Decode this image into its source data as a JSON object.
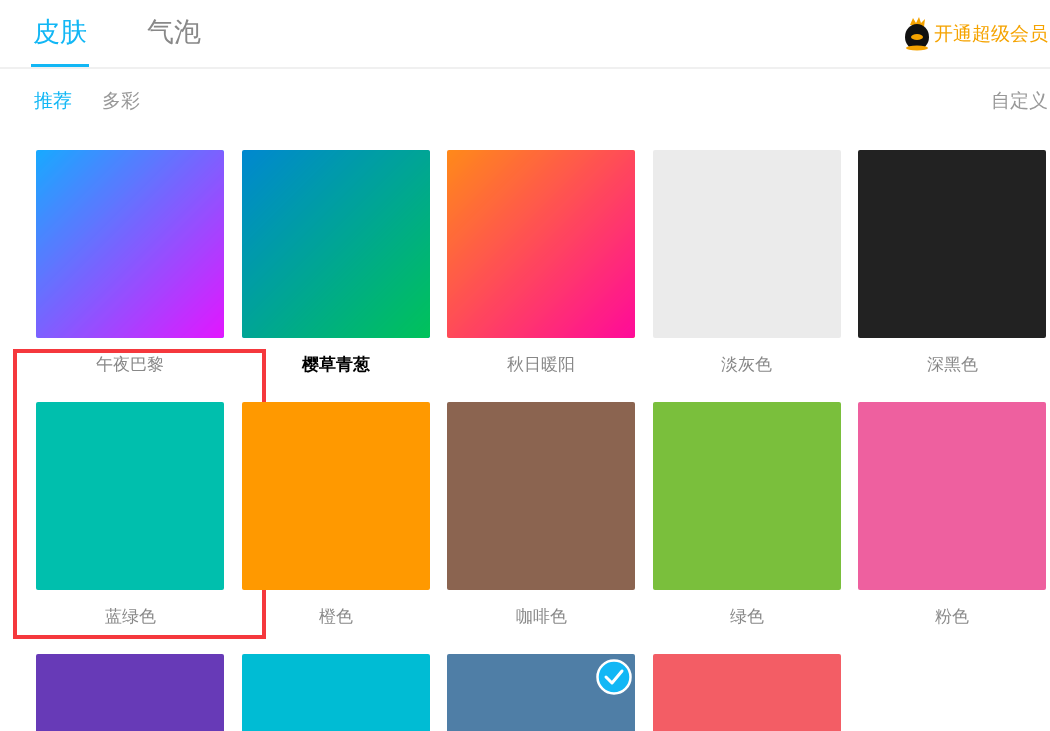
{
  "tabs": [
    {
      "label": "皮肤",
      "selected": true
    },
    {
      "label": "气泡",
      "selected": false
    }
  ],
  "vip_link": "开通超级会员",
  "subtabs": [
    {
      "label": "推荐",
      "selected": true
    },
    {
      "label": "多彩",
      "selected": false
    }
  ],
  "custom_link": "自定义",
  "skins": [
    {
      "name": "午夜巴黎",
      "kind": "gradient",
      "color": "#18aaff",
      "gradient_end": {
        "color": "#e316ff"
      },
      "selected": false,
      "hovered": false,
      "annotated": false
    },
    {
      "name": "樱草青葱",
      "kind": "gradient",
      "color": "#0088d0",
      "gradient_end": {
        "color": "#00c25a"
      },
      "selected": false,
      "hovered": true,
      "annotated": false
    },
    {
      "name": "秋日暖阳",
      "kind": "gradient",
      "color": "#ff8a1a",
      "gradient_end": {
        "color": "#ff0a9a"
      },
      "selected": false,
      "hovered": false,
      "annotated": false
    },
    {
      "name": "淡灰色",
      "kind": "solid",
      "color": "#ebebeb",
      "selected": false,
      "hovered": false,
      "annotated": false
    },
    {
      "name": "深黑色",
      "kind": "solid",
      "color": "#222222",
      "selected": false,
      "hovered": false,
      "annotated": false
    },
    {
      "name": "蓝绿色",
      "kind": "solid",
      "color": "#00bfad",
      "selected": false,
      "hovered": false,
      "annotated": true
    },
    {
      "name": "橙色",
      "kind": "solid",
      "color": "#ff9900",
      "selected": false,
      "hovered": false,
      "annotated": false
    },
    {
      "name": "咖啡色",
      "kind": "solid",
      "color": "#8b6450",
      "selected": false,
      "hovered": false,
      "annotated": false
    },
    {
      "name": "绿色",
      "kind": "solid",
      "color": "#7abf3c",
      "selected": false,
      "hovered": false,
      "annotated": false
    },
    {
      "name": "粉色",
      "kind": "solid",
      "color": "#ee609f",
      "selected": false,
      "hovered": false,
      "annotated": false
    },
    {
      "kind": "solid",
      "color": "#673ab7",
      "selected": false,
      "annotated": false
    },
    {
      "kind": "solid",
      "color": "#00bcd4",
      "selected": false,
      "annotated": false
    },
    {
      "kind": "solid",
      "color": "#4f7ea6",
      "selected": true,
      "annotated": false
    },
    {
      "kind": "solid",
      "color": "#f35d65",
      "selected": false,
      "annotated": false
    }
  ]
}
